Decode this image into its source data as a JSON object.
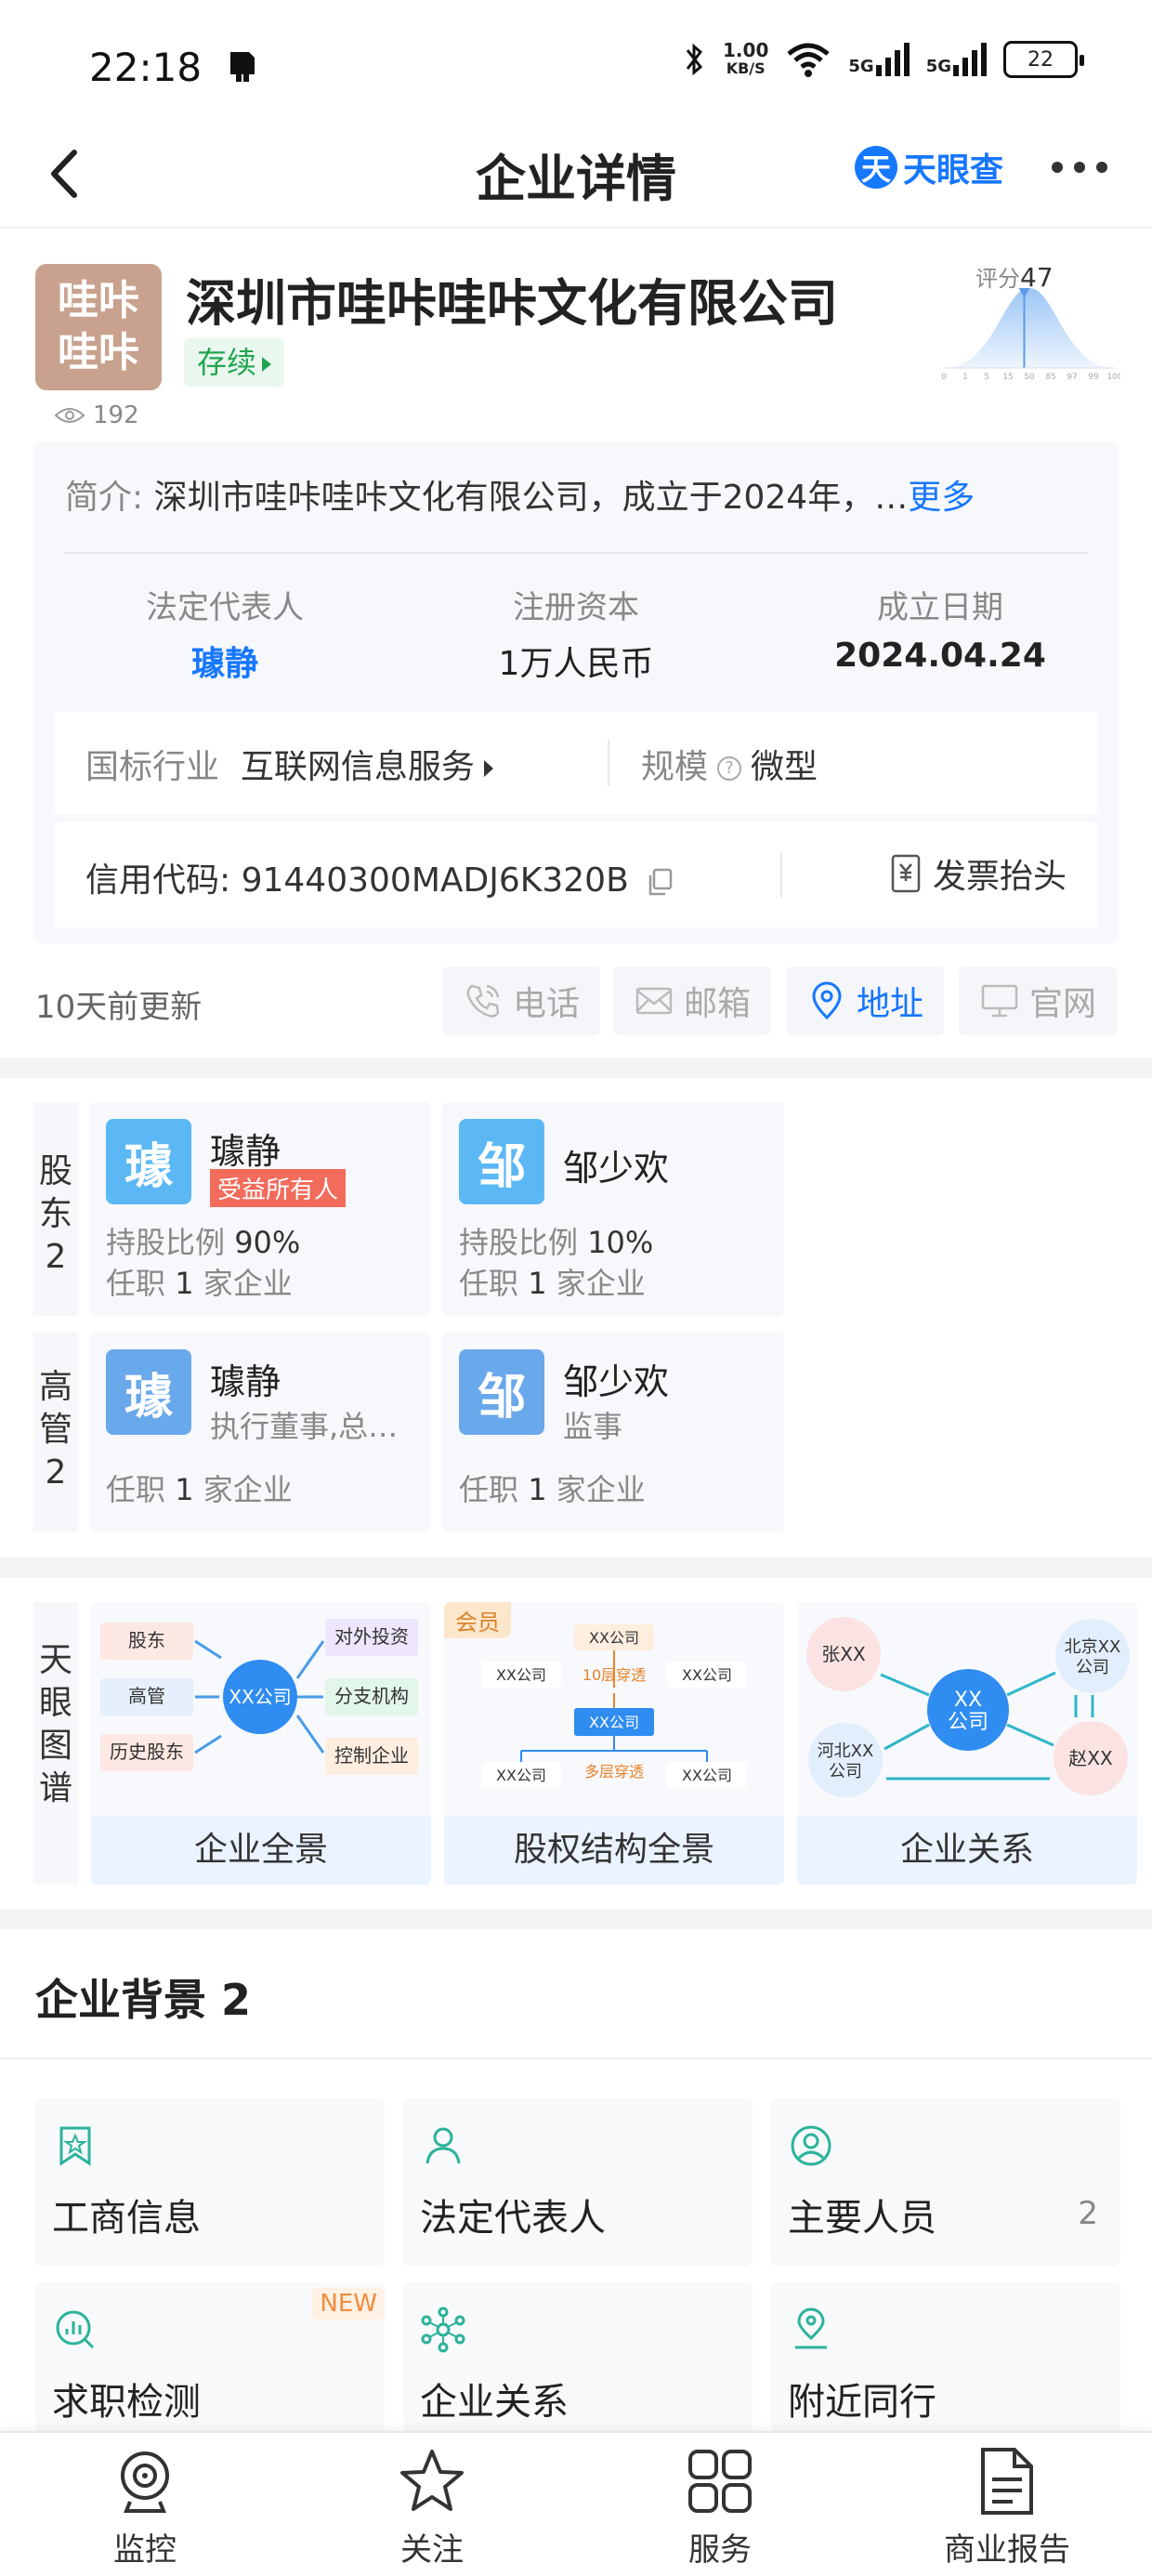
{
  "status_bar": {
    "time": "22:18",
    "speed_value": "1.00",
    "speed_unit": "KB/S",
    "net1": "5G",
    "net2": "5G",
    "battery": "22"
  },
  "nav": {
    "title": "企业详情",
    "brand": "天眼查",
    "brand_icon_char": "天"
  },
  "company": {
    "logo_line1": "哇咔",
    "logo_line2": "哇咔",
    "name": "深圳市哇咔哇咔文化有限公司",
    "status": "存续",
    "views": "192",
    "score_label": "评分",
    "score_value": "47",
    "score_ticks": [
      "0",
      "1",
      "5",
      "15",
      "50",
      "85",
      "97",
      "99",
      "100"
    ],
    "score_level": 0.47,
    "intro_label": "简介:",
    "intro_text": "深圳市哇咔哇咔文化有限公司，成立于2024年，…",
    "intro_more": "更多",
    "legal_rep_label": "法定代表人",
    "legal_rep": "璩静",
    "capital_label": "注册资本",
    "capital": "1万人民币",
    "founded_label": "成立日期",
    "founded": "2024.04.24",
    "industry_label": "国标行业",
    "industry": "互联网信息服务",
    "scale_label": "规模",
    "scale": "微型",
    "credit_label": "信用代码:",
    "credit_code": "91440300MADJ6K320B",
    "invoice": "发票抬头"
  },
  "update_text": "10天前更新",
  "actions": [
    {
      "label": "电话",
      "icon": "phone-icon",
      "active": false
    },
    {
      "label": "邮箱",
      "icon": "mail-icon",
      "active": false
    },
    {
      "label": "地址",
      "icon": "location-icon",
      "active": true
    },
    {
      "label": "官网",
      "icon": "monitor-icon",
      "active": false
    }
  ],
  "shareholders": {
    "side_label": "股东",
    "count": "2",
    "items": [
      {
        "avatar": "璩",
        "name": "璩静",
        "tag": "受益所有人",
        "ratio_label": "持股比例",
        "ratio": "90%",
        "posts_pre": "任职",
        "posts_num": "1",
        "posts_post": "家企业",
        "color": "#5bb8f5"
      },
      {
        "avatar": "邹",
        "name": "邹少欢",
        "ratio_label": "持股比例",
        "ratio": "10%",
        "posts_pre": "任职",
        "posts_num": "1",
        "posts_post": "家企业",
        "color": "#5bb8f5"
      }
    ]
  },
  "executives": {
    "side_label": "高管",
    "count": "2",
    "items": [
      {
        "avatar": "璩",
        "name": "璩静",
        "role": "执行董事,总…",
        "posts_pre": "任职",
        "posts_num": "1",
        "posts_post": "家企业",
        "color": "#6aa8ec"
      },
      {
        "avatar": "邹",
        "name": "邹少欢",
        "role": "监事",
        "posts_pre": "任职",
        "posts_num": "1",
        "posts_post": "家企业",
        "color": "#6aa8ec"
      }
    ]
  },
  "graph": {
    "side_label": "天眼图谱",
    "cards": [
      {
        "caption": "企业全景",
        "center": "XX公司",
        "left": [
          "股东",
          "高管",
          "历史股东"
        ],
        "right": [
          "对外投资",
          "分支机构",
          "控制企业"
        ]
      },
      {
        "caption": "股权结构全景",
        "vip": "会员",
        "top": "XX公司",
        "mid": "XX公司",
        "l1": "10层穿透",
        "l2": "多层穿透",
        "side": "XX公司"
      },
      {
        "caption": "企业关系",
        "center_l1": "XX",
        "center_l2": "公司",
        "n1": "张XX",
        "n2_l1": "北京XX",
        "n2_l2": "公司",
        "n3_l1": "河北XX",
        "n3_l2": "公司",
        "n4": "赵XX"
      }
    ]
  },
  "background": {
    "title": "企业背景",
    "count": "2",
    "tiles": [
      {
        "label": "工商信息",
        "icon": "bookmark-star-icon"
      },
      {
        "label": "法定代表人",
        "icon": "person-icon"
      },
      {
        "label": "主要人员",
        "icon": "person-circle-icon",
        "count": "2"
      },
      {
        "label": "求职检测",
        "icon": "search-chart-icon",
        "badge": "NEW"
      },
      {
        "label": "企业关系",
        "icon": "network-icon"
      },
      {
        "label": "附近同行",
        "icon": "person-location-icon"
      }
    ]
  },
  "tabbar": [
    {
      "label": "监控",
      "icon": "camera-icon"
    },
    {
      "label": "关注",
      "icon": "star-icon"
    },
    {
      "label": "服务",
      "icon": "grid-icon"
    },
    {
      "label": "商业报告",
      "icon": "document-icon"
    }
  ],
  "colors": {
    "accent": "#1677ff",
    "status_green": "#22a550",
    "beneficiary_tag": "#f26b5b"
  }
}
